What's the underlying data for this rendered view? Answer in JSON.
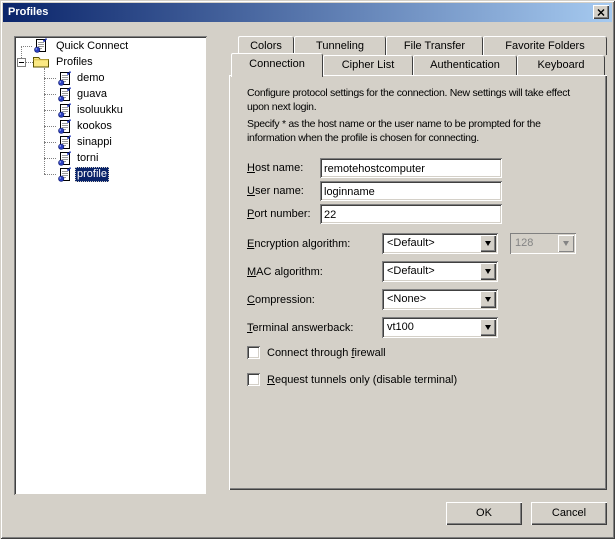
{
  "window": {
    "title": "Profiles"
  },
  "tree": {
    "items": [
      {
        "label": "Quick Connect",
        "level": 1
      },
      {
        "label": "Profiles",
        "level": 1,
        "expanded": true
      },
      {
        "label": "demo",
        "level": 2
      },
      {
        "label": "guava",
        "level": 2
      },
      {
        "label": "isoluukku",
        "level": 2
      },
      {
        "label": "kookos",
        "level": 2
      },
      {
        "label": "sinappi",
        "level": 2
      },
      {
        "label": "torni",
        "level": 2
      },
      {
        "label": "profile",
        "level": 2,
        "selected": true
      }
    ]
  },
  "tabs": {
    "back_row": [
      {
        "label": "Colors"
      },
      {
        "label": "Tunneling"
      },
      {
        "label": "File Transfer"
      },
      {
        "label": "Favorite Folders"
      }
    ],
    "front_row": [
      {
        "label": "Connection",
        "active": true
      },
      {
        "label": "Cipher List"
      },
      {
        "label": "Authentication"
      },
      {
        "label": "Keyboard"
      }
    ]
  },
  "connection": {
    "intro1": "Configure protocol settings for the connection. New settings will take effect\nupon next login.",
    "intro2": "Specify * as the host name or the user name to be prompted for the\ninformation when the profile is chosen for connecting.",
    "host": {
      "label": "Host name:",
      "accel": "H",
      "value": "remotehostcomputer"
    },
    "user": {
      "label": "User name:",
      "accel": "U",
      "value": "loginname"
    },
    "port": {
      "label": "Port number:",
      "accel": "P",
      "value": "22"
    },
    "encryption": {
      "label": "Encryption algorithm:",
      "accel": "E",
      "value": "<Default>"
    },
    "cipher_bits": {
      "value": "128",
      "disabled": true
    },
    "mac": {
      "label": "MAC algorithm:",
      "accel": "M",
      "value": "<Default>"
    },
    "compression": {
      "label": "Compression:",
      "accel": "C",
      "value": "<None>"
    },
    "answerback": {
      "label": "Terminal answerback:",
      "accel": "T",
      "value": "vt100"
    },
    "firewall": {
      "label": "Connect through firewall",
      "accel": "f",
      "checked": false
    },
    "tunnels": {
      "label": "Request tunnels only (disable terminal)",
      "accel": "R",
      "checked": false
    }
  },
  "buttons": {
    "ok": "OK",
    "cancel": "Cancel"
  },
  "colors": {
    "titlebar_start": "#0A246A",
    "titlebar_end": "#A6CAF0",
    "selection": "#0A246A",
    "dialog_bg": "#D4D0C8"
  }
}
